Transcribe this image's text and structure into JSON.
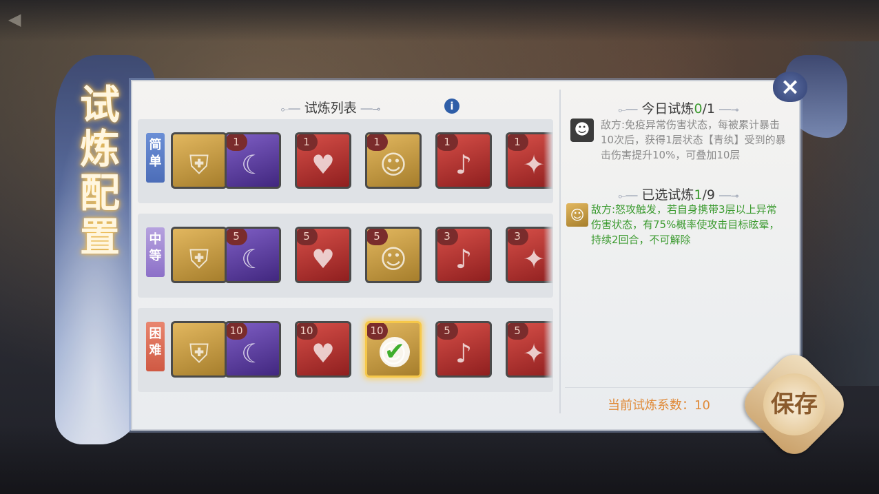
{
  "title_chars": [
    "试",
    "炼",
    "配",
    "置"
  ],
  "list_header": "试炼列表",
  "info_icon": "i",
  "close_icon": "×",
  "tiers": [
    {
      "label": "简单",
      "style": "easy",
      "icons": [
        {
          "name": "shield-guard-icon",
          "color": "gold",
          "badge": "",
          "glyph": "⛨",
          "selected": false
        },
        {
          "name": "dark-scythe-icon",
          "color": "purple",
          "badge": "1",
          "glyph": "☾",
          "selected": false
        },
        {
          "name": "broken-heart-icon",
          "color": "red",
          "badge": "1",
          "glyph": "♥",
          "selected": false
        },
        {
          "name": "dizzy-figure-icon",
          "color": "gold",
          "badge": "1",
          "glyph": "☺",
          "selected": false
        },
        {
          "name": "knockdown-figure-icon",
          "color": "red",
          "badge": "1",
          "glyph": "♪",
          "selected": false
        },
        {
          "name": "sparkle-figure-icon",
          "color": "red",
          "badge": "1",
          "glyph": "✦",
          "selected": false
        }
      ]
    },
    {
      "label": "中等",
      "style": "mid",
      "icons": [
        {
          "name": "shield-guard-icon",
          "color": "gold",
          "badge": "",
          "glyph": "⛨",
          "selected": false
        },
        {
          "name": "dark-scythe-icon",
          "color": "purple",
          "badge": "5",
          "glyph": "☾",
          "selected": false
        },
        {
          "name": "broken-heart-icon",
          "color": "red",
          "badge": "5",
          "glyph": "♥",
          "selected": false
        },
        {
          "name": "dizzy-figure-icon",
          "color": "gold",
          "badge": "5",
          "glyph": "☺",
          "selected": false
        },
        {
          "name": "knockdown-figure-icon",
          "color": "red",
          "badge": "3",
          "glyph": "♪",
          "selected": false
        },
        {
          "name": "sparkle-figure-icon",
          "color": "red",
          "badge": "3",
          "glyph": "✦",
          "selected": false
        }
      ]
    },
    {
      "label": "困难",
      "style": "hard",
      "icons": [
        {
          "name": "shield-guard-icon",
          "color": "gold",
          "badge": "",
          "glyph": "⛨",
          "selected": false
        },
        {
          "name": "dark-scythe-icon",
          "color": "purple",
          "badge": "10",
          "glyph": "☾",
          "selected": false
        },
        {
          "name": "broken-heart-icon",
          "color": "red",
          "badge": "10",
          "glyph": "♥",
          "selected": false
        },
        {
          "name": "dizzy-figure-icon",
          "color": "gold",
          "badge": "10",
          "glyph": "☺",
          "selected": true
        },
        {
          "name": "knockdown-figure-icon",
          "color": "red",
          "badge": "5",
          "glyph": "♪",
          "selected": false
        },
        {
          "name": "sparkle-figure-icon",
          "color": "red",
          "badge": "5",
          "glyph": "✦",
          "selected": false
        }
      ]
    }
  ],
  "today": {
    "label": "今日试炼",
    "current": "0",
    "total": "/1",
    "desc_icon": "☻",
    "description": "敌方:免疫异常伤害状态，每被累计暴击10次后，获得1层状态【青纨】受到的暴击伤害提升10%，可叠加10层"
  },
  "selected": {
    "label": "已选试炼",
    "current": "1",
    "total": "/9",
    "icon": "☺",
    "description": "敌方:怒攻触发，若自身携带3层以上异常伤害状态，有75%概率使攻击目标眩晕，持续2回合，不可解除"
  },
  "coefficient": {
    "label": "当前试炼系数：",
    "value": "10"
  },
  "save_label": "保存",
  "check_icon": "✔",
  "colors": {
    "accent_green": "#3b9a2f",
    "coefficient_orange": "#e08b3a",
    "selected_border": "#f6c84a"
  }
}
